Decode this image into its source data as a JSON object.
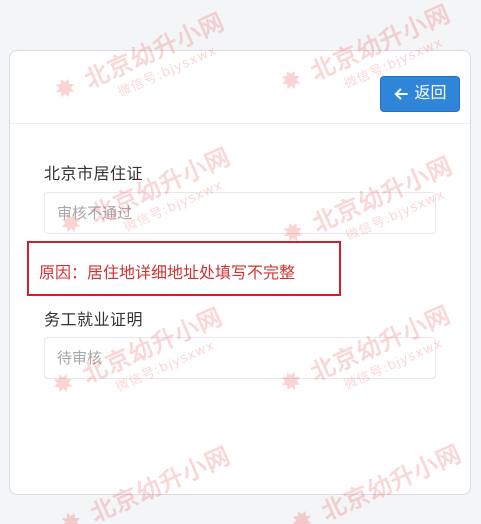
{
  "header": {
    "back_button": {
      "label": "返回",
      "icon": "arrow-left-icon"
    }
  },
  "documents": [
    {
      "title": "北京市居住证",
      "status": "审核不通过"
    },
    {
      "title": "务工就业证明",
      "status": "待审核"
    }
  ],
  "rejection": {
    "reason": "原因：居住地详细地址处填写不完整",
    "color": "#d3322f"
  },
  "watermark": {
    "brand": "北京幼升小网",
    "wechat": "微信号:bjysxwx",
    "color": "#e63535"
  },
  "colors": {
    "primary": "#2f86d8",
    "error": "#d0202c",
    "text": "#333333",
    "placeholder": "#a7a7a7"
  }
}
